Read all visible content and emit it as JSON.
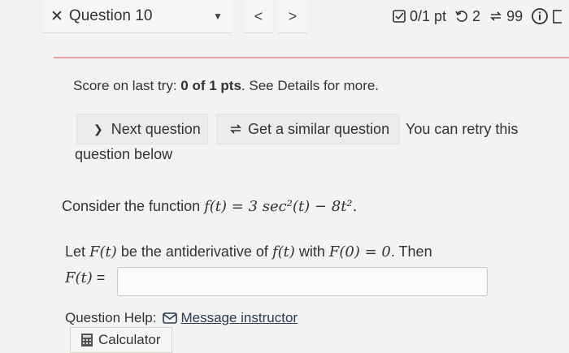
{
  "header": {
    "question_label": "Question 10",
    "prev_glyph": "<",
    "next_glyph": ">",
    "points": "0/1 pt",
    "attempts": "2",
    "similar_count": "99"
  },
  "score": {
    "prefix": "Score on last try: ",
    "value": "0 of 1 pts",
    "suffix": ". See Details for more."
  },
  "actions": {
    "next_question": "Next question",
    "similar_question": "Get a similar question",
    "retry_line1": "You can retry this",
    "retry_line2": "question below"
  },
  "question": {
    "consider_text": "Consider the function ",
    "function_expr": "f(t) = 3 sec²(t) − 8t².",
    "let_text_1": "Let ",
    "F_t": "F(t)",
    "let_text_2": " be the antiderivative of ",
    "f_t": "f(t)",
    "let_text_3": " with ",
    "condition": "F(0) = 0",
    "let_text_4": ". Then",
    "answer_label_math": "F(t)",
    "answer_label_eq": " =",
    "answer_value": ""
  },
  "help": {
    "label": "Question Help:",
    "message_link": "Message instructor",
    "calculator": "Calculator"
  },
  "colors": {
    "accent_rule": "#e7a3a3",
    "background": "#f3f3f1"
  }
}
